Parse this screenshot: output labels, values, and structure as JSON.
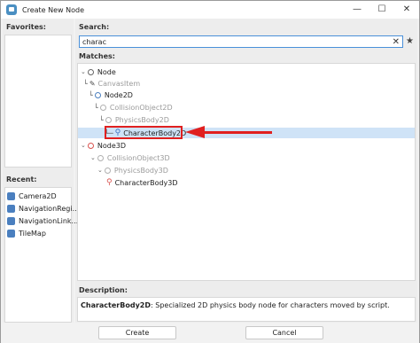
{
  "window": {
    "title": "Create New Node"
  },
  "favorites": {
    "header": "Favorites:"
  },
  "recent": {
    "header": "Recent:",
    "items": [
      {
        "label": "Camera2D",
        "icon": "camera2d-icon",
        "color": "#4a7fbf"
      },
      {
        "label": "NavigationRegi...",
        "icon": "navigation-region-icon",
        "color": "#4a7fbf"
      },
      {
        "label": "NavigationLink...",
        "icon": "navigation-link-icon",
        "color": "#4a7fbf"
      },
      {
        "label": "TileMap",
        "icon": "tilemap-icon",
        "color": "#4a7fbf"
      }
    ]
  },
  "search": {
    "header": "Search:",
    "value": "charac"
  },
  "matches": {
    "header": "Matches:",
    "tree": [
      {
        "label": "Node",
        "guide": "",
        "caret": "⌄",
        "icon": "node-icon",
        "style": "grey",
        "dim": false
      },
      {
        "label": "CanvasItem",
        "guide": "└",
        "caret": "",
        "icon": "canvasitem-icon",
        "style": "pencil",
        "dim": true
      },
      {
        "label": "Node2D",
        "guide": "└",
        "caret": "⌄",
        "icon": "node2d-icon",
        "style": "blue",
        "dim": false
      },
      {
        "label": "CollisionObject2D",
        "guide": "└",
        "caret": "⌄",
        "icon": "collisionobject2d-icon",
        "style": "grey",
        "dim": true
      },
      {
        "label": "PhysicsBody2D",
        "guide": "└",
        "caret": "⌄",
        "icon": "physicsbody2d-icon",
        "style": "grey",
        "dim": true
      },
      {
        "label": "CharacterBody2D",
        "guide": "└─",
        "caret": "",
        "icon": "characterbody2d-icon",
        "style": "person-blue",
        "dim": false
      },
      {
        "label": "Node3D",
        "guide": "",
        "caret": "⌄",
        "icon": "node3d-icon",
        "style": "red",
        "dim": false
      },
      {
        "label": "CollisionObject3D",
        "guide": "",
        "caret": "⌄",
        "icon": "collisionobject3d-icon",
        "style": "grey",
        "dim": true
      },
      {
        "label": "PhysicsBody3D",
        "guide": "",
        "caret": "⌄",
        "icon": "physicsbody3d-icon",
        "style": "grey",
        "dim": true
      },
      {
        "label": "CharacterBody3D",
        "guide": "",
        "caret": "",
        "icon": "characterbody3d-icon",
        "style": "person-red",
        "dim": false
      }
    ]
  },
  "description": {
    "header": "Description:",
    "node_name": "CharacterBody2D",
    "text": ": Specialized 2D physics body node for characters moved by script."
  },
  "buttons": {
    "create": "Create",
    "cancel": "Cancel"
  },
  "colors": {
    "accent": "#4a90d9",
    "selection": "#cfe3f7",
    "annotation": "#e02020"
  }
}
